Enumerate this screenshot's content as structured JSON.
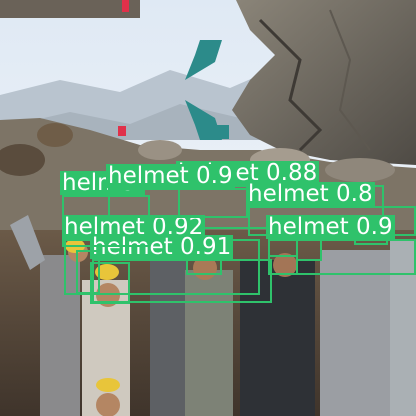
{
  "detection": {
    "box_color": "#2fc26b",
    "label_text_color": "#ffffff",
    "detections": [
      {
        "label": "helmet",
        "score": "0.88"
      },
      {
        "label": "helmet",
        "score": "0.8"
      },
      {
        "label": "helmet",
        "score": "0.92"
      },
      {
        "label": "helmet",
        "score": "0.91"
      },
      {
        "label": "helmet",
        "score": "0.9"
      },
      {
        "label": "helmet",
        "score": "0.9"
      },
      {
        "label": "helmet",
        "score": "0.9"
      }
    ]
  }
}
